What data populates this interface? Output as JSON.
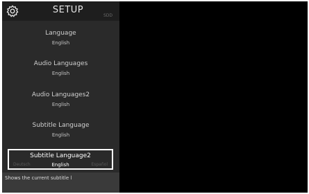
{
  "header": {
    "title": "SETUP",
    "badge": "SDD",
    "icon": "gear-icon"
  },
  "menu": {
    "items": [
      {
        "label": "Language",
        "value": "English"
      },
      {
        "label": "Audio Languages",
        "value": "English"
      },
      {
        "label": "Audio Languages2",
        "value": "English"
      },
      {
        "label": "Subtitle Language",
        "value": "English"
      },
      {
        "label": "Subtitle Language2",
        "value": "English",
        "selected": true,
        "prev_option": "Deutsch",
        "next_option": "Español"
      }
    ]
  },
  "footer": {
    "help_text": "Shows the current subtitle l"
  },
  "colors": {
    "panel": "#2a2a2a",
    "header": "#1e1e1e",
    "footer": "#3a3a3a",
    "highlight_border": "#ffffff"
  }
}
